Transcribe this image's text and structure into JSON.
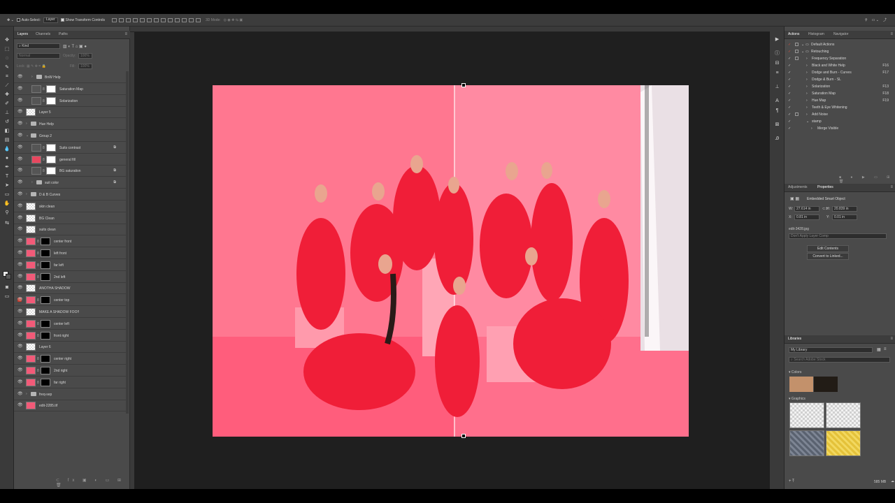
{
  "options_bar": {
    "auto_select_label": "Auto-Select:",
    "auto_select_value": "Layer",
    "show_transform_label": "Show Transform Controls",
    "mode_3d": "3D Mode:"
  },
  "layers_panel": {
    "tabs": [
      "Layers",
      "Channels",
      "Paths"
    ],
    "filter_kind": "Kind",
    "blend_mode": "Normal",
    "opacity_label": "Opacity:",
    "opacity_value": "100%",
    "lock_label": "Lock:",
    "fill_label": "Fill:",
    "fill_value": "100%",
    "layers": [
      {
        "name": "BnW Help",
        "type": "group",
        "indent": 1
      },
      {
        "name": "Saturation Map",
        "type": "adjust",
        "indent": 1
      },
      {
        "name": "Solarization",
        "type": "adjust",
        "indent": 1
      },
      {
        "name": "Layer 5",
        "type": "layer",
        "indent": 0
      },
      {
        "name": "Hue Help",
        "type": "group",
        "indent": 0
      },
      {
        "name": "Group 2",
        "type": "group-open",
        "indent": 0
      },
      {
        "name": "Suits contrast",
        "type": "adjust",
        "indent": 1,
        "fx": true
      },
      {
        "name": "general fill",
        "type": "fill",
        "indent": 1
      },
      {
        "name": "BG saturation",
        "type": "adjust",
        "indent": 1,
        "fx": true
      },
      {
        "name": "suit color",
        "type": "group",
        "indent": 1,
        "fx": true
      },
      {
        "name": "D & B Curves",
        "type": "group",
        "indent": 0
      },
      {
        "name": "skin clean",
        "type": "layer",
        "indent": 0
      },
      {
        "name": "BG Clean",
        "type": "layer",
        "indent": 0
      },
      {
        "name": "suits clean",
        "type": "layer",
        "indent": 0
      },
      {
        "name": "center front",
        "type": "masked",
        "indent": 0
      },
      {
        "name": "left front",
        "type": "masked",
        "indent": 0
      },
      {
        "name": "far left",
        "type": "masked",
        "indent": 0
      },
      {
        "name": "2nd left",
        "type": "masked",
        "indent": 0
      },
      {
        "name": "ANOTHA SHADOW",
        "type": "layer",
        "indent": 0
      },
      {
        "name": "center top",
        "type": "masked",
        "indent": 0,
        "red": true
      },
      {
        "name": "MAKE A SHADOW FOO!!",
        "type": "layer",
        "indent": 0
      },
      {
        "name": "center left",
        "type": "masked",
        "indent": 0
      },
      {
        "name": "front right",
        "type": "masked",
        "indent": 0
      },
      {
        "name": "Layer 6",
        "type": "layer",
        "indent": 0
      },
      {
        "name": "center right",
        "type": "masked",
        "indent": 0
      },
      {
        "name": "2nd right",
        "type": "masked",
        "indent": 0
      },
      {
        "name": "far right",
        "type": "masked",
        "indent": 0
      },
      {
        "name": "freq-sep",
        "type": "group",
        "indent": 0
      },
      {
        "name": "edit-2285.tif",
        "type": "photo",
        "indent": 0
      }
    ]
  },
  "actions_panel": {
    "tabs": [
      "Actions",
      "Histogram",
      "Navigator"
    ],
    "items": [
      {
        "name": "Default Actions",
        "level": 0,
        "key": ""
      },
      {
        "name": "Retouching",
        "level": 0,
        "key": ""
      },
      {
        "name": "Frequency Separation",
        "level": 1,
        "key": ""
      },
      {
        "name": "Black and White Help",
        "level": 1,
        "key": "F16"
      },
      {
        "name": "Dodge and Burn - Curves",
        "level": 1,
        "key": "F17"
      },
      {
        "name": "Dodge & Burn - SL",
        "level": 1,
        "key": ""
      },
      {
        "name": "Solarization",
        "level": 1,
        "key": "F13"
      },
      {
        "name": "Saturation Map",
        "level": 1,
        "key": "F18"
      },
      {
        "name": "Hue Map",
        "level": 1,
        "key": "F19"
      },
      {
        "name": "Teeth & Eye Whitening",
        "level": 1,
        "key": ""
      },
      {
        "name": "Add Noise",
        "level": 1,
        "key": ""
      },
      {
        "name": "stamp",
        "level": 1,
        "key": ""
      },
      {
        "name": "Merge Visible",
        "level": 2,
        "key": ""
      }
    ]
  },
  "properties_panel": {
    "tabs": [
      "Adjustments",
      "Properties"
    ],
    "object_type": "Embedded Smart Object",
    "w_label": "W:",
    "w_value": "27.614 in",
    "h_label": "H:",
    "h_value": "20.839 in",
    "x_label": "X:",
    "x_value": "0.81 in",
    "y_label": "Y:",
    "y_value": "0.01 in",
    "filename": "edit-3428.jpg",
    "layer_comp": "Don't Apply Layer Comp",
    "edit_contents": "Edit Contents",
    "convert_linked": "Convert to Linked..."
  },
  "libraries_panel": {
    "title": "Libraries",
    "library": "My Library",
    "search_placeholder": "Search Adobe Stock",
    "colors_label": "Colors",
    "graphics_label": "Graphics",
    "colors": [
      "#c3916b",
      "#221c16"
    ],
    "size": "585 MB"
  }
}
